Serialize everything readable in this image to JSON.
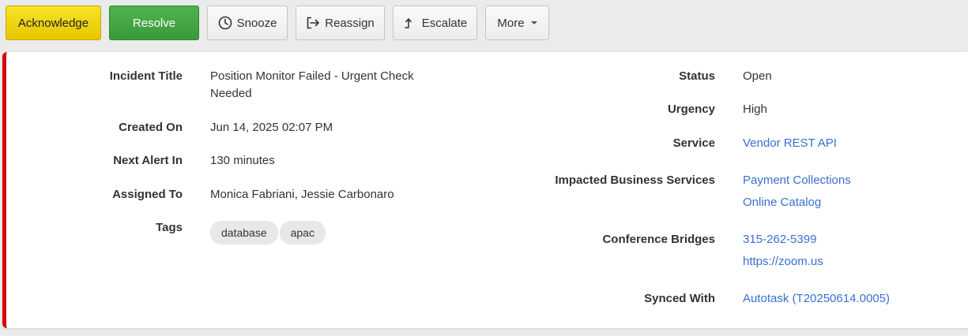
{
  "toolbar": {
    "acknowledge": "Acknowledge",
    "resolve": "Resolve",
    "snooze": "Snooze",
    "reassign": "Reassign",
    "escalate": "Escalate",
    "more": "More"
  },
  "incident": {
    "left": {
      "title_label": "Incident Title",
      "title": "Position Monitor Failed - Urgent Check Needed",
      "created_label": "Created On",
      "created": "Jun 14, 2025 02:07 PM",
      "next_alert_label": "Next Alert In",
      "next_alert": "130 minutes",
      "assigned_label": "Assigned To",
      "assigned": "Monica Fabriani, Jessie Carbonaro",
      "tags_label": "Tags",
      "tags": [
        "database",
        "apac"
      ]
    },
    "right": {
      "status_label": "Status",
      "status": "Open",
      "urgency_label": "Urgency",
      "urgency": "High",
      "service_label": "Service",
      "service": "Vendor REST API",
      "impacted_label": "Impacted Business Services",
      "impacted": [
        "Payment Collections",
        "Online Catalog"
      ],
      "bridges_label": "Conference Bridges",
      "bridges": [
        "315-262-5399",
        "https://zoom.us"
      ],
      "synced_label": "Synced With",
      "synced": "Autotask (T20250614.0005)"
    }
  },
  "colors": {
    "urgency_bar": "#d20a0a",
    "link": "#3a6fd1",
    "acknowledge_bg": "#f0d813",
    "resolve_bg": "#43a843"
  },
  "icons": {
    "snooze": "clock-icon",
    "reassign": "reassign-arrow-icon",
    "escalate": "escalate-arrow-icon",
    "more": "caret-down-icon"
  }
}
